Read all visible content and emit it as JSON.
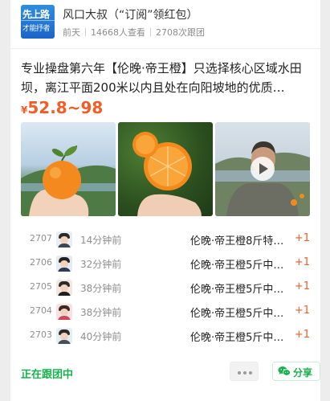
{
  "header": {
    "avatar_text_top": "先上路",
    "avatar_text_bottom": "才能抒者",
    "title": "风口大叔（“订阅”领红包）",
    "date": "前天",
    "views": "14668人查看",
    "follows": "2708次跟团"
  },
  "post": {
    "description": "专业操盘第六年【伦晚·帝王橙】只选择核心区域水田坝，离江平面200米以内且处在向阳坡地的优质…",
    "price_currency": "¥",
    "price_range": "52.8~98"
  },
  "photos": [
    {
      "name": "orange-on-hand-photo"
    },
    {
      "name": "cut-orange-photo"
    },
    {
      "name": "farmer-video-thumbnail",
      "is_video": true
    }
  ],
  "orders": [
    {
      "no": "2707",
      "time": "14分钟前",
      "item": "伦晚·帝王橙8斤特…",
      "qty": "+1"
    },
    {
      "no": "2706",
      "time": "32分钟前",
      "item": "伦晚·帝王橙5斤中…",
      "qty": "+1"
    },
    {
      "no": "2705",
      "time": "38分钟前",
      "item": "伦晚·帝王橙5斤中…",
      "qty": "+1"
    },
    {
      "no": "2704",
      "time": "38分钟前",
      "item": "伦晚·帝王橙5斤中…",
      "qty": "+1"
    },
    {
      "no": "2703",
      "time": "40分钟前",
      "item": "伦晚·帝王橙5斤中…",
      "qty": "+1"
    }
  ],
  "footer": {
    "status": "正在跟团中",
    "share_label": "分享"
  },
  "colors": {
    "price": "#f25c26",
    "accent_green": "#15b24c",
    "avatar_blue": "#1b64c8"
  }
}
